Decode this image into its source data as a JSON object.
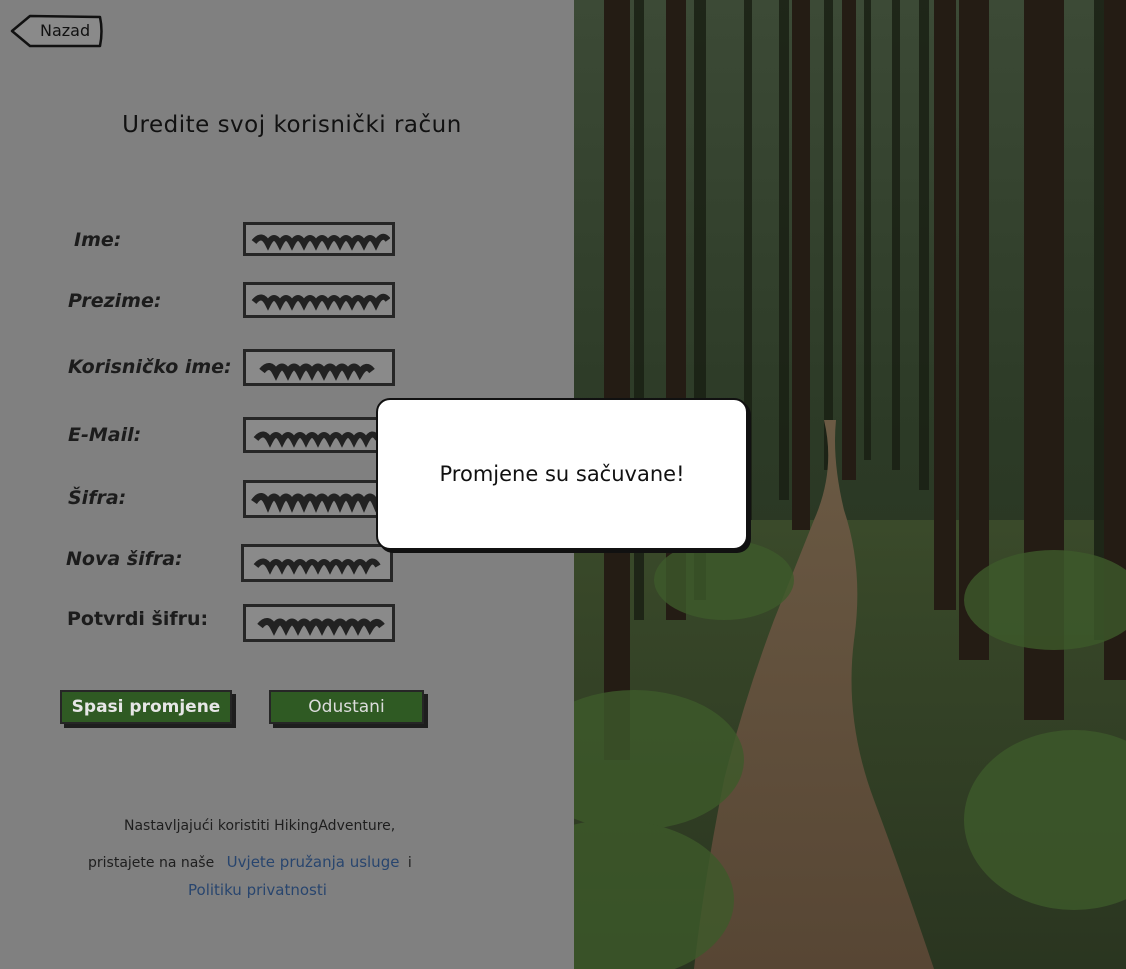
{
  "header": {
    "back_label": "Nazad"
  },
  "page": {
    "title": "Uredite svoj korisnički račun"
  },
  "form": {
    "fields": [
      {
        "label": "Ime:"
      },
      {
        "label": "Prezime:"
      },
      {
        "label": "Korisničko ime:"
      },
      {
        "label": "E-Mail:"
      },
      {
        "label": "Šifra:"
      },
      {
        "label": "Nova šifra:"
      },
      {
        "label": "Potvrdi šifru:"
      }
    ],
    "save_label": "Spasi promjene",
    "cancel_label": "Odustani"
  },
  "footer": {
    "line1": "Nastavljajući koristiti HikingAdventure,",
    "line2_prefix": "pristajete na naše",
    "terms_link": "Uvjete pružanja usluge",
    "conjunction": "i",
    "privacy_link": "Politiku privatnosti"
  },
  "toast": {
    "message": "Promjene su sačuvane!"
  },
  "colors": {
    "overlay": "#808080",
    "button": "#2f5a23",
    "link": "#28456e"
  }
}
